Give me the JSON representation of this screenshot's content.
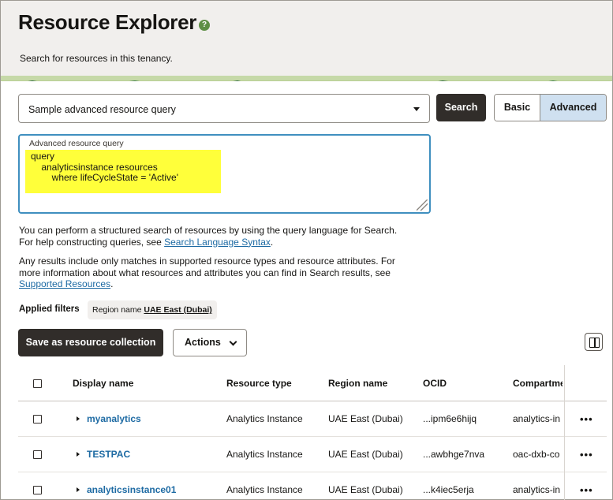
{
  "header": {
    "title": "Resource Explorer",
    "subtitle": "Search for resources in this tenancy."
  },
  "query": {
    "sample_select_value": "Sample advanced resource query",
    "search_label": "Search",
    "mode_basic": "Basic",
    "mode_advanced": "Advanced",
    "mode_selected": "Advanced",
    "editor_label": "Advanced resource query",
    "editor_lines": [
      "query",
      "    analyticsinstance resources",
      "        where lifeCycleState = 'Active'"
    ]
  },
  "help": {
    "p1_line1": "You can perform a structured search of resources by using the query language for Search.",
    "p1_line2_prefix": "For help constructing queries, see ",
    "p1_link": "Search Language Syntax",
    "p1_suffix": ".",
    "p2_line1": "Any results include only matches in supported resource types and resource attributes. For",
    "p2_line2": "more information about what resources and attributes you can find in Search results, see",
    "p2_link": "Supported Resources",
    "p2_suffix": "."
  },
  "filters": {
    "label": "Applied filters",
    "chip_key": "Region name",
    "chip_value": "UAE East (Dubai)"
  },
  "toolbar": {
    "save_label": "Save as resource collection",
    "actions_label": "Actions"
  },
  "table": {
    "headers": [
      "Display name",
      "Resource type",
      "Region name",
      "OCID",
      "Compartme"
    ],
    "rows": [
      {
        "name": "myanalytics",
        "type": "Analytics Instance",
        "region": "UAE East (Dubai)",
        "ocid": "...ipm6e6hijq",
        "compartment": "analytics-in"
      },
      {
        "name": "TESTPAC",
        "type": "Analytics Instance",
        "region": "UAE East (Dubai)",
        "ocid": "...awbhge7nva",
        "compartment": "oac-dxb-co"
      },
      {
        "name": "analyticsinstance01",
        "type": "Analytics Instance",
        "region": "UAE East (Dubai)",
        "ocid": "...k4iec5erja",
        "compartment": "analytics-in"
      }
    ],
    "more_label": "•••"
  },
  "colors": {
    "accent": "#3f8fbf",
    "highlight": "#ffff3a",
    "link": "#1d6aa3",
    "dark_button": "#312d2a",
    "status_ok": "#5e8f45"
  },
  "icons": {
    "help": "help-circle-icon",
    "dropdown": "chevron-down-icon",
    "columns": "manage-columns-icon",
    "expand": "expand-row-icon",
    "row_menu": "more-horizontal-icon"
  }
}
